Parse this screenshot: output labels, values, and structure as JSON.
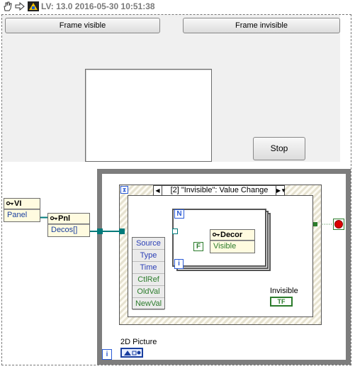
{
  "toolbar": {
    "title": "LV: 13.0 2016-05-30 10:51:38",
    "icons": [
      "hand-pointer-icon",
      "arrow-icon",
      "vi-icon"
    ]
  },
  "front_panel": {
    "frame_visible_label": "Frame visible",
    "frame_invisible_label": "Frame invisible",
    "stop_label": "Stop"
  },
  "block_diagram": {
    "event_case": "[2] \"Invisible\": Value Change",
    "vi_node": {
      "class": "VI",
      "property": "Panel"
    },
    "pnl_node": {
      "class": "Pnl",
      "property": "Decos[]"
    },
    "decor_node": {
      "class": "Decor",
      "property": "Visible"
    },
    "event_data": [
      "Source",
      "Type",
      "Time",
      "CtlRef",
      "OldVal",
      "NewVal"
    ],
    "for_loop_count": "N",
    "iteration_label": "i",
    "false_constant": "F",
    "invisible_terminal": {
      "label": "Invisible",
      "type": "TF"
    },
    "picture_terminal": {
      "label": "2D Picture"
    },
    "colors": {
      "wire_refnum": "#007a7a",
      "wire_bool": "#2c7c2c",
      "wire_picture": "#1a3f9f",
      "structure_border": "#7d7d7d"
    }
  }
}
